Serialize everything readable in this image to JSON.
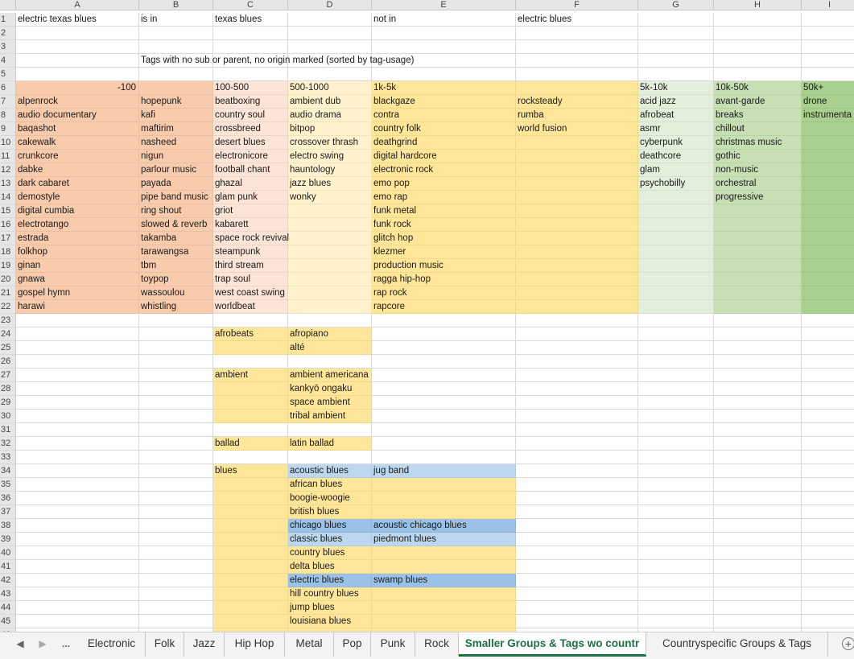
{
  "columns": [
    "A",
    "B",
    "C",
    "D",
    "E",
    "F",
    "G",
    "H",
    "I"
  ],
  "colors": {
    "orange": "#f8cbad",
    "peach": "#fce4d6",
    "cream": "#fff2cc",
    "yellow": "#ffe699",
    "lightgreen": "#e2efda",
    "green": "#c6e0b4",
    "darkgreen": "#a9d08e",
    "lightblue": "#bdd7ee",
    "blue": "#9bc2e6"
  },
  "rows": [
    {
      "num": "1",
      "cells": [
        {
          "col": "A",
          "text": "electric texas blues"
        },
        {
          "col": "B",
          "text": "is in"
        },
        {
          "col": "C",
          "text": "texas blues"
        },
        {
          "col": "E",
          "text": "not in"
        },
        {
          "col": "F",
          "text": "electric blues"
        }
      ]
    },
    {
      "num": "2",
      "cells": []
    },
    {
      "num": "3",
      "cells": []
    },
    {
      "num": "4",
      "cells": [
        {
          "col": "B",
          "text": "Tags with no sub or parent, no origin marked (sorted by tag-usage)"
        }
      ]
    },
    {
      "num": "5",
      "cells": []
    },
    {
      "num": "6",
      "cells": [
        {
          "col": "A",
          "text": "-100",
          "align": "right"
        },
        {
          "col": "B",
          "text": ""
        },
        {
          "col": "C",
          "text": "100-500"
        },
        {
          "col": "D",
          "text": "500-1000"
        },
        {
          "col": "E",
          "text": "1k-5k"
        },
        {
          "col": "F",
          "text": ""
        },
        {
          "col": "G",
          "text": "5k-10k"
        },
        {
          "col": "H",
          "text": "10k-50k"
        },
        {
          "col": "I",
          "text": "50k+"
        }
      ]
    },
    {
      "num": "7",
      "cells": [
        {
          "col": "A",
          "text": "alpenrock"
        },
        {
          "col": "B",
          "text": "hopepunk"
        },
        {
          "col": "C",
          "text": "beatboxing"
        },
        {
          "col": "D",
          "text": "ambient dub"
        },
        {
          "col": "E",
          "text": "blackgaze"
        },
        {
          "col": "F",
          "text": "rocksteady"
        },
        {
          "col": "G",
          "text": "acid jazz"
        },
        {
          "col": "H",
          "text": "avant-garde"
        },
        {
          "col": "I",
          "text": "drone"
        }
      ]
    },
    {
      "num": "8",
      "cells": [
        {
          "col": "A",
          "text": "audio documentary"
        },
        {
          "col": "B",
          "text": "kafi"
        },
        {
          "col": "C",
          "text": "country soul"
        },
        {
          "col": "D",
          "text": "audio drama"
        },
        {
          "col": "E",
          "text": "contra"
        },
        {
          "col": "F",
          "text": "rumba"
        },
        {
          "col": "G",
          "text": "afrobeat"
        },
        {
          "col": "H",
          "text": "breaks"
        },
        {
          "col": "I",
          "text": "instrumenta"
        }
      ]
    },
    {
      "num": "9",
      "cells": [
        {
          "col": "A",
          "text": "baqashot"
        },
        {
          "col": "B",
          "text": "maftirim"
        },
        {
          "col": "C",
          "text": "crossbreed"
        },
        {
          "col": "D",
          "text": "bitpop"
        },
        {
          "col": "E",
          "text": "country folk"
        },
        {
          "col": "F",
          "text": "world fusion"
        },
        {
          "col": "G",
          "text": "asmr"
        },
        {
          "col": "H",
          "text": "chillout"
        },
        {
          "col": "I",
          "text": ""
        }
      ]
    },
    {
      "num": "10",
      "cells": [
        {
          "col": "A",
          "text": "cakewalk"
        },
        {
          "col": "B",
          "text": "nasheed"
        },
        {
          "col": "C",
          "text": "desert blues"
        },
        {
          "col": "D",
          "text": "crossover thrash"
        },
        {
          "col": "E",
          "text": "deathgrind"
        },
        {
          "col": "F",
          "text": ""
        },
        {
          "col": "G",
          "text": "cyberpunk"
        },
        {
          "col": "H",
          "text": "christmas music"
        },
        {
          "col": "I",
          "text": ""
        }
      ]
    },
    {
      "num": "11",
      "cells": [
        {
          "col": "A",
          "text": "crunkcore"
        },
        {
          "col": "B",
          "text": "nigun"
        },
        {
          "col": "C",
          "text": "electronicore"
        },
        {
          "col": "D",
          "text": "electro swing"
        },
        {
          "col": "E",
          "text": "digital hardcore"
        },
        {
          "col": "F",
          "text": ""
        },
        {
          "col": "G",
          "text": "deathcore"
        },
        {
          "col": "H",
          "text": "gothic"
        },
        {
          "col": "I",
          "text": ""
        }
      ]
    },
    {
      "num": "12",
      "cells": [
        {
          "col": "A",
          "text": "dabke"
        },
        {
          "col": "B",
          "text": "parlour music"
        },
        {
          "col": "C",
          "text": "football chant"
        },
        {
          "col": "D",
          "text": "hauntology"
        },
        {
          "col": "E",
          "text": "electronic rock"
        },
        {
          "col": "F",
          "text": ""
        },
        {
          "col": "G",
          "text": "glam"
        },
        {
          "col": "H",
          "text": "non-music"
        },
        {
          "col": "I",
          "text": ""
        }
      ]
    },
    {
      "num": "13",
      "cells": [
        {
          "col": "A",
          "text": "dark cabaret"
        },
        {
          "col": "B",
          "text": "payada"
        },
        {
          "col": "C",
          "text": "ghazal"
        },
        {
          "col": "D",
          "text": "jazz blues"
        },
        {
          "col": "E",
          "text": "emo pop"
        },
        {
          "col": "F",
          "text": ""
        },
        {
          "col": "G",
          "text": "psychobilly"
        },
        {
          "col": "H",
          "text": "orchestral"
        },
        {
          "col": "I",
          "text": ""
        }
      ]
    },
    {
      "num": "14",
      "cells": [
        {
          "col": "A",
          "text": "demostyle"
        },
        {
          "col": "B",
          "text": "pipe band music"
        },
        {
          "col": "C",
          "text": "glam punk"
        },
        {
          "col": "D",
          "text": "wonky"
        },
        {
          "col": "E",
          "text": "emo rap"
        },
        {
          "col": "F",
          "text": ""
        },
        {
          "col": "G",
          "text": ""
        },
        {
          "col": "H",
          "text": "progressive"
        },
        {
          "col": "I",
          "text": ""
        }
      ]
    },
    {
      "num": "15",
      "cells": [
        {
          "col": "A",
          "text": "digital cumbia"
        },
        {
          "col": "B",
          "text": "ring shout"
        },
        {
          "col": "C",
          "text": "griot"
        },
        {
          "col": "D",
          "text": ""
        },
        {
          "col": "E",
          "text": "funk metal"
        },
        {
          "col": "F",
          "text": ""
        },
        {
          "col": "G",
          "text": ""
        },
        {
          "col": "H",
          "text": ""
        },
        {
          "col": "I",
          "text": ""
        }
      ]
    },
    {
      "num": "16",
      "cells": [
        {
          "col": "A",
          "text": "electrotango"
        },
        {
          "col": "B",
          "text": "slowed & reverb"
        },
        {
          "col": "C",
          "text": "kabarett"
        },
        {
          "col": "D",
          "text": ""
        },
        {
          "col": "E",
          "text": "funk rock"
        },
        {
          "col": "F",
          "text": ""
        },
        {
          "col": "G",
          "text": ""
        },
        {
          "col": "H",
          "text": ""
        },
        {
          "col": "I",
          "text": ""
        }
      ]
    },
    {
      "num": "17",
      "cells": [
        {
          "col": "A",
          "text": "estrada"
        },
        {
          "col": "B",
          "text": "takamba"
        },
        {
          "col": "C",
          "text": "space rock revival",
          "ovf": true
        },
        {
          "col": "D",
          "text": ""
        },
        {
          "col": "E",
          "text": "glitch hop"
        },
        {
          "col": "F",
          "text": ""
        },
        {
          "col": "G",
          "text": ""
        },
        {
          "col": "H",
          "text": ""
        },
        {
          "col": "I",
          "text": ""
        }
      ]
    },
    {
      "num": "18",
      "cells": [
        {
          "col": "A",
          "text": "folkhop"
        },
        {
          "col": "B",
          "text": "tarawangsa"
        },
        {
          "col": "C",
          "text": "steampunk"
        },
        {
          "col": "D",
          "text": ""
        },
        {
          "col": "E",
          "text": "klezmer"
        },
        {
          "col": "F",
          "text": ""
        },
        {
          "col": "G",
          "text": ""
        },
        {
          "col": "H",
          "text": ""
        },
        {
          "col": "I",
          "text": ""
        }
      ]
    },
    {
      "num": "19",
      "cells": [
        {
          "col": "A",
          "text": "ginan"
        },
        {
          "col": "B",
          "text": "tbm"
        },
        {
          "col": "C",
          "text": "third stream"
        },
        {
          "col": "D",
          "text": ""
        },
        {
          "col": "E",
          "text": "production music"
        },
        {
          "col": "F",
          "text": ""
        },
        {
          "col": "G",
          "text": ""
        },
        {
          "col": "H",
          "text": ""
        },
        {
          "col": "I",
          "text": ""
        }
      ]
    },
    {
      "num": "20",
      "cells": [
        {
          "col": "A",
          "text": "gnawa"
        },
        {
          "col": "B",
          "text": "toypop"
        },
        {
          "col": "C",
          "text": "trap soul"
        },
        {
          "col": "D",
          "text": ""
        },
        {
          "col": "E",
          "text": "ragga hip-hop"
        },
        {
          "col": "F",
          "text": ""
        },
        {
          "col": "G",
          "text": ""
        },
        {
          "col": "H",
          "text": ""
        },
        {
          "col": "I",
          "text": ""
        }
      ]
    },
    {
      "num": "21",
      "cells": [
        {
          "col": "A",
          "text": "gospel hymn"
        },
        {
          "col": "B",
          "text": "wassoulou"
        },
        {
          "col": "C",
          "text": "west coast swing",
          "ovf": true
        },
        {
          "col": "D",
          "text": ""
        },
        {
          "col": "E",
          "text": "rap rock"
        },
        {
          "col": "F",
          "text": ""
        },
        {
          "col": "G",
          "text": ""
        },
        {
          "col": "H",
          "text": ""
        },
        {
          "col": "I",
          "text": ""
        }
      ]
    },
    {
      "num": "22",
      "cells": [
        {
          "col": "A",
          "text": "harawi"
        },
        {
          "col": "B",
          "text": "whistling"
        },
        {
          "col": "C",
          "text": "worldbeat"
        },
        {
          "col": "D",
          "text": ""
        },
        {
          "col": "E",
          "text": "rapcore"
        },
        {
          "col": "F",
          "text": ""
        },
        {
          "col": "G",
          "text": ""
        },
        {
          "col": "H",
          "text": ""
        },
        {
          "col": "I",
          "text": ""
        }
      ]
    },
    {
      "num": "23",
      "cells": []
    },
    {
      "num": "24",
      "cells": [
        {
          "col": "C",
          "text": "afrobeats"
        },
        {
          "col": "D",
          "text": "afropiano"
        }
      ]
    },
    {
      "num": "25",
      "cells": [
        {
          "col": "C",
          "text": ""
        },
        {
          "col": "D",
          "text": "alté"
        }
      ]
    },
    {
      "num": "26",
      "cells": []
    },
    {
      "num": "27",
      "cells": [
        {
          "col": "C",
          "text": "ambient"
        },
        {
          "col": "D",
          "text": "ambient americana",
          "ovf": true
        }
      ]
    },
    {
      "num": "28",
      "cells": [
        {
          "col": "C",
          "text": ""
        },
        {
          "col": "D",
          "text": "kankyō ongaku"
        }
      ]
    },
    {
      "num": "29",
      "cells": [
        {
          "col": "C",
          "text": ""
        },
        {
          "col": "D",
          "text": "space ambient"
        }
      ]
    },
    {
      "num": "30",
      "cells": [
        {
          "col": "C",
          "text": ""
        },
        {
          "col": "D",
          "text": "tribal ambient"
        }
      ]
    },
    {
      "num": "31",
      "cells": []
    },
    {
      "num": "32",
      "cells": [
        {
          "col": "C",
          "text": "ballad"
        },
        {
          "col": "D",
          "text": "latin ballad"
        }
      ]
    },
    {
      "num": "33",
      "cells": []
    },
    {
      "num": "34",
      "cells": [
        {
          "col": "C",
          "text": "blues"
        },
        {
          "col": "D",
          "text": "acoustic blues"
        },
        {
          "col": "E",
          "text": "jug band"
        }
      ]
    },
    {
      "num": "35",
      "cells": [
        {
          "col": "C",
          "text": ""
        },
        {
          "col": "D",
          "text": "african blues"
        },
        {
          "col": "E",
          "text": ""
        }
      ]
    },
    {
      "num": "36",
      "cells": [
        {
          "col": "C",
          "text": ""
        },
        {
          "col": "D",
          "text": "boogie-woogie"
        },
        {
          "col": "E",
          "text": ""
        }
      ]
    },
    {
      "num": "37",
      "cells": [
        {
          "col": "C",
          "text": ""
        },
        {
          "col": "D",
          "text": "british blues"
        },
        {
          "col": "E",
          "text": ""
        }
      ]
    },
    {
      "num": "38",
      "cells": [
        {
          "col": "C",
          "text": ""
        },
        {
          "col": "D",
          "text": "chicago blues"
        },
        {
          "col": "E",
          "text": "acoustic chicago blues"
        }
      ]
    },
    {
      "num": "39",
      "cells": [
        {
          "col": "C",
          "text": ""
        },
        {
          "col": "D",
          "text": "classic blues"
        },
        {
          "col": "E",
          "text": "piedmont blues"
        }
      ]
    },
    {
      "num": "40",
      "cells": [
        {
          "col": "C",
          "text": ""
        },
        {
          "col": "D",
          "text": "country blues"
        },
        {
          "col": "E",
          "text": ""
        }
      ]
    },
    {
      "num": "41",
      "cells": [
        {
          "col": "C",
          "text": ""
        },
        {
          "col": "D",
          "text": "delta blues"
        },
        {
          "col": "E",
          "text": ""
        }
      ]
    },
    {
      "num": "42",
      "cells": [
        {
          "col": "C",
          "text": ""
        },
        {
          "col": "D",
          "text": "electric blues"
        },
        {
          "col": "E",
          "text": "swamp blues"
        }
      ]
    },
    {
      "num": "43",
      "cells": [
        {
          "col": "C",
          "text": ""
        },
        {
          "col": "D",
          "text": "hill country blues"
        },
        {
          "col": "E",
          "text": ""
        }
      ]
    },
    {
      "num": "44",
      "cells": [
        {
          "col": "C",
          "text": ""
        },
        {
          "col": "D",
          "text": "jump blues"
        },
        {
          "col": "E",
          "text": ""
        }
      ]
    },
    {
      "num": "45",
      "cells": [
        {
          "col": "C",
          "text": ""
        },
        {
          "col": "D",
          "text": "louisiana blues"
        },
        {
          "col": "E",
          "text": ""
        }
      ]
    },
    {
      "num": "46",
      "cells": [
        {
          "col": "C",
          "text": ""
        },
        {
          "col": "D",
          "text": ""
        },
        {
          "col": "E",
          "text": ""
        }
      ]
    }
  ],
  "tabs": {
    "nav": {
      "prev": "◀",
      "next": "▶",
      "more": "..."
    },
    "items": [
      {
        "label": "Electronic",
        "active": false
      },
      {
        "label": "Folk",
        "active": false
      },
      {
        "label": "Jazz",
        "active": false
      },
      {
        "label": "Hip Hop",
        "active": false
      },
      {
        "label": "Metal",
        "active": false
      },
      {
        "label": "Pop",
        "active": false
      },
      {
        "label": "Punk",
        "active": false
      },
      {
        "label": "Rock",
        "active": false
      },
      {
        "label": "Smaller Groups & Tags wo countr",
        "active": true
      },
      {
        "label": "Countryspecific Groups & Tags",
        "active": false
      }
    ],
    "add_label": "+"
  }
}
